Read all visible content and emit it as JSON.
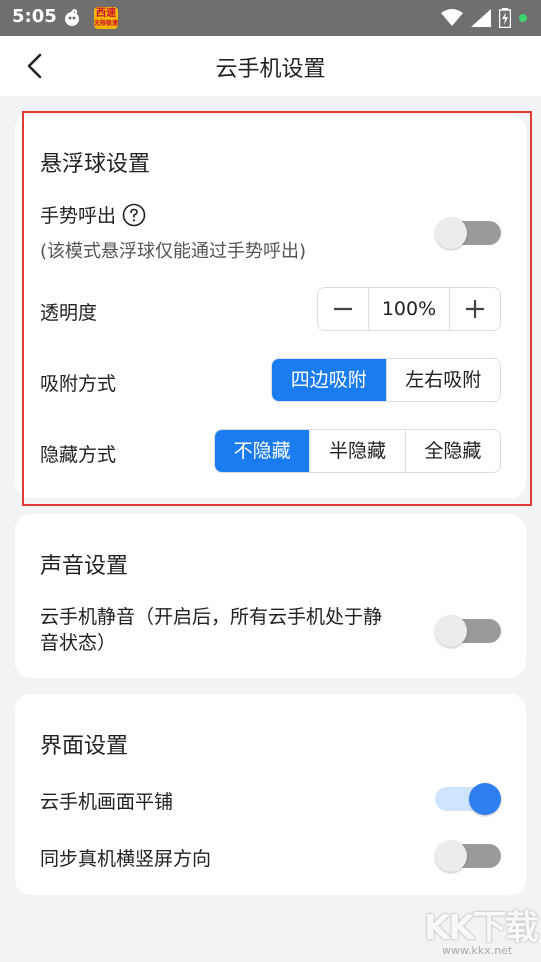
{
  "status_bar": {
    "time": "5:05",
    "app_badge_main": "西速",
    "app_badge_sub": "无限极速"
  },
  "header": {
    "title": "云手机设置"
  },
  "float_settings": {
    "title": "悬浮球设置",
    "gesture_label": "手势呼出",
    "gesture_sub": "(该模式悬浮球仅能通过手势呼出)",
    "gesture_on": false,
    "opacity_label": "透明度",
    "opacity_value": "100%",
    "attach_label": "吸附方式",
    "attach_options": [
      "四边吸附",
      "左右吸附"
    ],
    "attach_selected": "四边吸附",
    "hide_label": "隐藏方式",
    "hide_options": [
      "不隐藏",
      "半隐藏",
      "全隐藏"
    ],
    "hide_selected": "不隐藏"
  },
  "sound_settings": {
    "title": "声音设置",
    "mute_label_line1": "云手机静音（开启后，所有云手机处于静",
    "mute_label_line2": "音状态）",
    "mute_on": false
  },
  "ui_settings": {
    "title": "界面设置",
    "tile_label": "云手机画面平铺",
    "tile_on": true,
    "sync_label": "同步真机横竖屏方向",
    "sync_on": false
  },
  "watermark": {
    "text": "KK下载",
    "url": "www.kkx.net"
  },
  "colors": {
    "accent": "#1a7cf0",
    "highlight_border": "#e53935",
    "status_bar": "#6f6f6f"
  }
}
